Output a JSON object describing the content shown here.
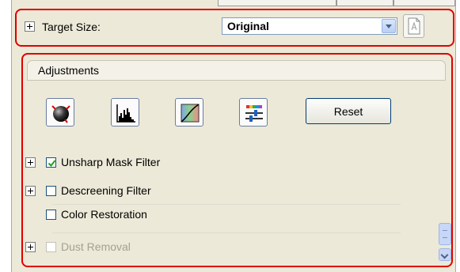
{
  "target_size": {
    "label": "Target Size:",
    "selected": "Original"
  },
  "adjustments": {
    "title": "Adjustments",
    "tools": [
      {
        "icon": "auto-exposure-icon"
      },
      {
        "icon": "histogram-icon"
      },
      {
        "icon": "tone-correction-icon"
      },
      {
        "icon": "color-palette-icon"
      }
    ],
    "reset_label": "Reset",
    "options": [
      {
        "label": "Unsharp Mask Filter",
        "checked": true,
        "expandable": true,
        "enabled": true
      },
      {
        "label": "Descreening Filter",
        "checked": false,
        "expandable": true,
        "enabled": true
      },
      {
        "label": "Color Restoration",
        "checked": false,
        "expandable": false,
        "enabled": true
      },
      {
        "label": "Dust Removal",
        "checked": false,
        "expandable": true,
        "enabled": false
      }
    ]
  },
  "colors": {
    "highlight": "#e00000",
    "panel": "#ece9d8"
  }
}
